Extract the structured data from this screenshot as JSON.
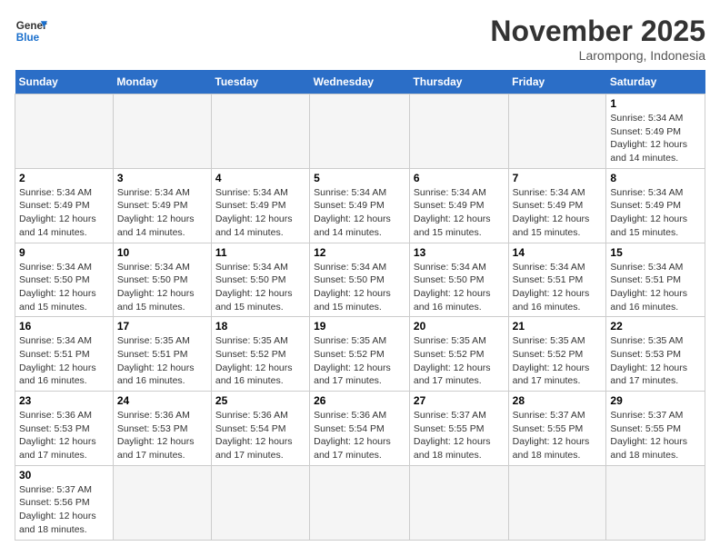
{
  "logo": {
    "general": "General",
    "blue": "Blue"
  },
  "title": "November 2025",
  "location": "Larompong, Indonesia",
  "days_header": [
    "Sunday",
    "Monday",
    "Tuesday",
    "Wednesday",
    "Thursday",
    "Friday",
    "Saturday"
  ],
  "weeks": [
    [
      {
        "day": "",
        "info": ""
      },
      {
        "day": "",
        "info": ""
      },
      {
        "day": "",
        "info": ""
      },
      {
        "day": "",
        "info": ""
      },
      {
        "day": "",
        "info": ""
      },
      {
        "day": "",
        "info": ""
      },
      {
        "day": "1",
        "info": "Sunrise: 5:34 AM\nSunset: 5:49 PM\nDaylight: 12 hours and 14 minutes."
      }
    ],
    [
      {
        "day": "2",
        "info": "Sunrise: 5:34 AM\nSunset: 5:49 PM\nDaylight: 12 hours and 14 minutes."
      },
      {
        "day": "3",
        "info": "Sunrise: 5:34 AM\nSunset: 5:49 PM\nDaylight: 12 hours and 14 minutes."
      },
      {
        "day": "4",
        "info": "Sunrise: 5:34 AM\nSunset: 5:49 PM\nDaylight: 12 hours and 14 minutes."
      },
      {
        "day": "5",
        "info": "Sunrise: 5:34 AM\nSunset: 5:49 PM\nDaylight: 12 hours and 14 minutes."
      },
      {
        "day": "6",
        "info": "Sunrise: 5:34 AM\nSunset: 5:49 PM\nDaylight: 12 hours and 15 minutes."
      },
      {
        "day": "7",
        "info": "Sunrise: 5:34 AM\nSunset: 5:49 PM\nDaylight: 12 hours and 15 minutes."
      },
      {
        "day": "8",
        "info": "Sunrise: 5:34 AM\nSunset: 5:49 PM\nDaylight: 12 hours and 15 minutes."
      }
    ],
    [
      {
        "day": "9",
        "info": "Sunrise: 5:34 AM\nSunset: 5:50 PM\nDaylight: 12 hours and 15 minutes."
      },
      {
        "day": "10",
        "info": "Sunrise: 5:34 AM\nSunset: 5:50 PM\nDaylight: 12 hours and 15 minutes."
      },
      {
        "day": "11",
        "info": "Sunrise: 5:34 AM\nSunset: 5:50 PM\nDaylight: 12 hours and 15 minutes."
      },
      {
        "day": "12",
        "info": "Sunrise: 5:34 AM\nSunset: 5:50 PM\nDaylight: 12 hours and 15 minutes."
      },
      {
        "day": "13",
        "info": "Sunrise: 5:34 AM\nSunset: 5:50 PM\nDaylight: 12 hours and 16 minutes."
      },
      {
        "day": "14",
        "info": "Sunrise: 5:34 AM\nSunset: 5:51 PM\nDaylight: 12 hours and 16 minutes."
      },
      {
        "day": "15",
        "info": "Sunrise: 5:34 AM\nSunset: 5:51 PM\nDaylight: 12 hours and 16 minutes."
      }
    ],
    [
      {
        "day": "16",
        "info": "Sunrise: 5:34 AM\nSunset: 5:51 PM\nDaylight: 12 hours and 16 minutes."
      },
      {
        "day": "17",
        "info": "Sunrise: 5:35 AM\nSunset: 5:51 PM\nDaylight: 12 hours and 16 minutes."
      },
      {
        "day": "18",
        "info": "Sunrise: 5:35 AM\nSunset: 5:52 PM\nDaylight: 12 hours and 16 minutes."
      },
      {
        "day": "19",
        "info": "Sunrise: 5:35 AM\nSunset: 5:52 PM\nDaylight: 12 hours and 17 minutes."
      },
      {
        "day": "20",
        "info": "Sunrise: 5:35 AM\nSunset: 5:52 PM\nDaylight: 12 hours and 17 minutes."
      },
      {
        "day": "21",
        "info": "Sunrise: 5:35 AM\nSunset: 5:52 PM\nDaylight: 12 hours and 17 minutes."
      },
      {
        "day": "22",
        "info": "Sunrise: 5:35 AM\nSunset: 5:53 PM\nDaylight: 12 hours and 17 minutes."
      }
    ],
    [
      {
        "day": "23",
        "info": "Sunrise: 5:36 AM\nSunset: 5:53 PM\nDaylight: 12 hours and 17 minutes."
      },
      {
        "day": "24",
        "info": "Sunrise: 5:36 AM\nSunset: 5:53 PM\nDaylight: 12 hours and 17 minutes."
      },
      {
        "day": "25",
        "info": "Sunrise: 5:36 AM\nSunset: 5:54 PM\nDaylight: 12 hours and 17 minutes."
      },
      {
        "day": "26",
        "info": "Sunrise: 5:36 AM\nSunset: 5:54 PM\nDaylight: 12 hours and 17 minutes."
      },
      {
        "day": "27",
        "info": "Sunrise: 5:37 AM\nSunset: 5:55 PM\nDaylight: 12 hours and 18 minutes."
      },
      {
        "day": "28",
        "info": "Sunrise: 5:37 AM\nSunset: 5:55 PM\nDaylight: 12 hours and 18 minutes."
      },
      {
        "day": "29",
        "info": "Sunrise: 5:37 AM\nSunset: 5:55 PM\nDaylight: 12 hours and 18 minutes."
      }
    ],
    [
      {
        "day": "30",
        "info": "Sunrise: 5:37 AM\nSunset: 5:56 PM\nDaylight: 12 hours and 18 minutes."
      },
      {
        "day": "",
        "info": ""
      },
      {
        "day": "",
        "info": ""
      },
      {
        "day": "",
        "info": ""
      },
      {
        "day": "",
        "info": ""
      },
      {
        "day": "",
        "info": ""
      },
      {
        "day": "",
        "info": ""
      }
    ]
  ]
}
